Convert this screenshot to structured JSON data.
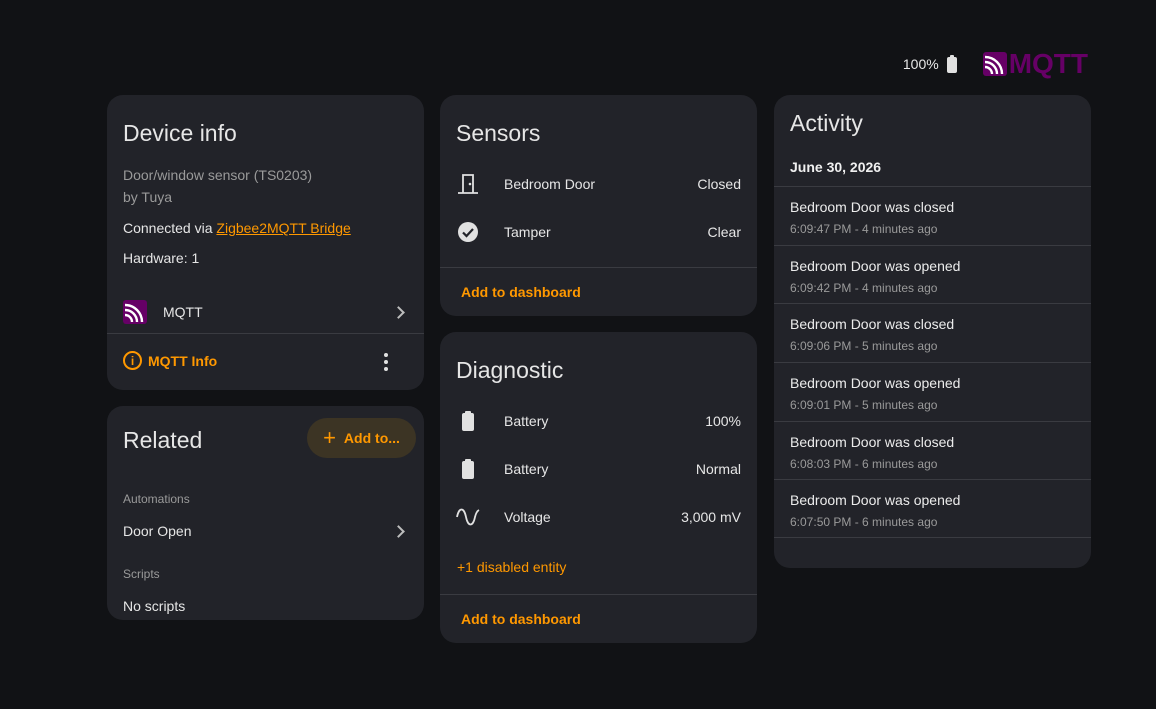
{
  "topbar": {
    "battery_level": "100%",
    "brand_name": "MQTT"
  },
  "device_info": {
    "title": "Device info",
    "model": "Door/window sensor (TS0203)",
    "manufacturer": "by Tuya",
    "connected_prefix": "Connected via ",
    "connected_link": "Zigbee2MQTT Bridge",
    "hardware": "Hardware: 1",
    "integration_label": "MQTT",
    "mqtt_info_label": "MQTT Info"
  },
  "related": {
    "title": "Related",
    "add_button_label": "Add to...",
    "automations_header": "Automations",
    "automation_item": "Door Open",
    "scripts_header": "Scripts",
    "scripts_empty": "No scripts"
  },
  "sensors": {
    "title": "Sensors",
    "entities": [
      {
        "icon": "door-icon",
        "name": "Bedroom Door",
        "value": "Closed"
      },
      {
        "icon": "check-circle-icon",
        "name": "Tamper",
        "value": "Clear"
      }
    ],
    "add_to_dashboard": "Add to dashboard"
  },
  "diagnostic": {
    "title": "Diagnostic",
    "entities": [
      {
        "icon": "battery-icon",
        "name": "Battery",
        "value": "100%"
      },
      {
        "icon": "battery-icon",
        "name": "Battery",
        "value": "Normal"
      },
      {
        "icon": "sine-wave-icon",
        "name": "Voltage",
        "value": "3,000 mV"
      }
    ],
    "disabled_entities": "+1 disabled entity",
    "add_to_dashboard": "Add to dashboard"
  },
  "activity": {
    "title": "Activity",
    "date": "June 30, 2026",
    "items": [
      {
        "message": "Bedroom Door was closed",
        "time": "6:09:47 PM - 4 minutes ago"
      },
      {
        "message": "Bedroom Door was opened",
        "time": "6:09:42 PM - 4 minutes ago"
      },
      {
        "message": "Bedroom Door was closed",
        "time": "6:09:06 PM - 5 minutes ago"
      },
      {
        "message": "Bedroom Door was opened",
        "time": "6:09:01 PM - 5 minutes ago"
      },
      {
        "message": "Bedroom Door was closed",
        "time": "6:08:03 PM - 6 minutes ago"
      },
      {
        "message": "Bedroom Door was opened",
        "time": "6:07:50 PM - 6 minutes ago"
      }
    ]
  },
  "colors": {
    "accent": "#ff9800",
    "brand": "#660066",
    "background": "#111215",
    "card": "#222329"
  }
}
